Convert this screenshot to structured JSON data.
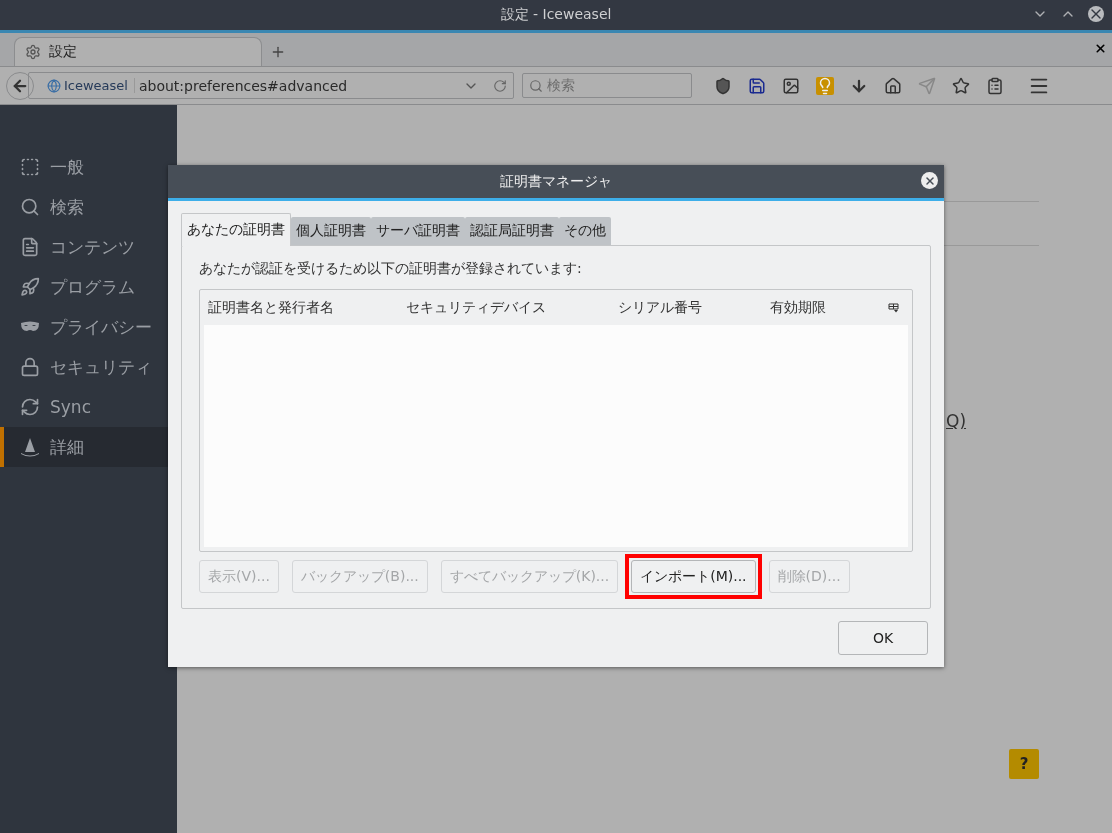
{
  "window": {
    "title": "設定 - Iceweasel"
  },
  "browser_tabs": [
    {
      "label": "設定",
      "selected": true
    }
  ],
  "navbar": {
    "identity": "Iceweasel",
    "url": "about:preferences#advanced",
    "search": {
      "placeholder": "検索"
    }
  },
  "sidebar": {
    "items": [
      {
        "label": "一般",
        "selected": false
      },
      {
        "label": "検索",
        "selected": false
      },
      {
        "label": "コンテンツ",
        "selected": false
      },
      {
        "label": "プログラム",
        "selected": false
      },
      {
        "label": "プライバシー",
        "selected": false
      },
      {
        "label": "セキュリティ",
        "selected": false
      },
      {
        "label": "Sync",
        "selected": false
      },
      {
        "label": "詳細",
        "selected": true
      }
    ]
  },
  "page": {
    "fragment": "Q)",
    "help": "?"
  },
  "dialog": {
    "title": "証明書マネージャ",
    "tabs": [
      {
        "label": "あなたの証明書",
        "selected": true
      },
      {
        "label": "個人証明書",
        "selected": false
      },
      {
        "label": "サーバ証明書",
        "selected": false
      },
      {
        "label": "認証局証明書",
        "selected": false
      },
      {
        "label": "その他",
        "selected": false
      }
    ],
    "description": "あなたが認証を受けるため以下の証明書が登録されています:",
    "table": {
      "columns": [
        "証明書名と発行者名",
        "セキュリティデバイス",
        "シリアル番号",
        "有効期限"
      ]
    },
    "buttons": [
      {
        "label": "表示(V)...",
        "disabled": true,
        "highlighted": false
      },
      {
        "label": "バックアップ(B)...",
        "disabled": true,
        "highlighted": false
      },
      {
        "label": "すべてバックアップ(K)...",
        "disabled": true,
        "highlighted": false
      },
      {
        "label": "インポート(M)...",
        "disabled": false,
        "highlighted": true
      },
      {
        "label": "削除(D)...",
        "disabled": true,
        "highlighted": false
      }
    ],
    "ok": "OK"
  }
}
